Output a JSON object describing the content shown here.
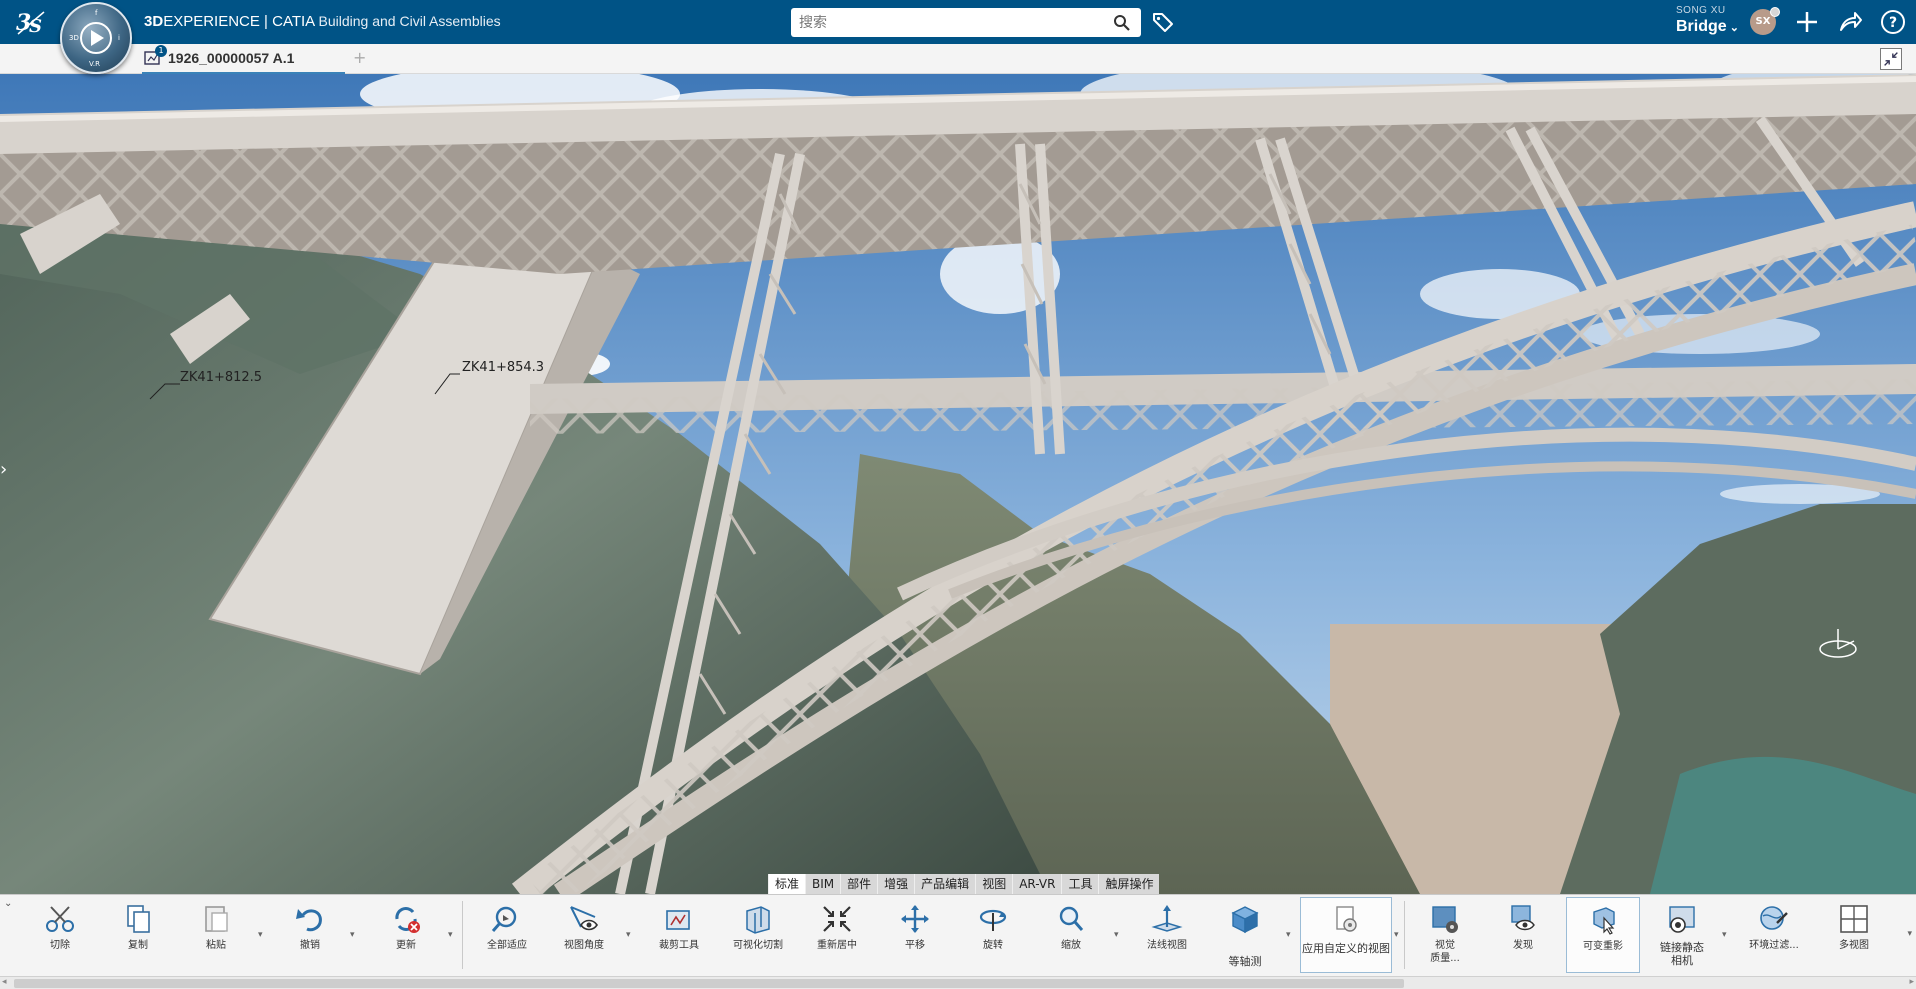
{
  "header": {
    "brand_bold": "3D",
    "brand_rest": "EXPERIENCE | CATIA",
    "app_subtitle": "Building and Civil Assemblies",
    "compass_labels": [
      "3D",
      "V.R",
      "i",
      "f"
    ],
    "search_placeholder": "搜索",
    "user_name": "SONG XU",
    "workspace": "Bridge",
    "avatar_initials": "SX",
    "accent_color": "#005386"
  },
  "tabs": {
    "doc_title": "1926_00000057 A.1",
    "doc_badge": "1",
    "add_label": "+"
  },
  "viewport": {
    "annotations": [
      "ZK41+812.5",
      "ZK41+854.3"
    ]
  },
  "section_tabs": [
    "标准",
    "BIM",
    "部件",
    "增强",
    "产品编辑",
    "视图",
    "AR-VR",
    "工具",
    "触屏操作"
  ],
  "active_section": "标准",
  "toolbar": {
    "cut": "切除",
    "copy": "复制",
    "paste": "粘贴",
    "undo": "撤销",
    "update": "更新",
    "fit_all": "全部适应",
    "view_angle": "视图角度",
    "clip_tool": "裁剪工具",
    "visual_clip": "可视化切割",
    "recenter": "重新居中",
    "pan": "平移",
    "rotate": "旋转",
    "zoom": "缩放",
    "normal_view": "法线视图",
    "isometric": "等轴测",
    "custom_view": "应用自定义的视图",
    "visual_quality_1": "视觉",
    "visual_quality_2": "质量...",
    "discover": "发现",
    "ghost_projection": "可变重影",
    "link_camera_1": "链接静态",
    "link_camera_2": "相机",
    "env_filter": "环境过滤...",
    "multi_view": "多视图"
  }
}
